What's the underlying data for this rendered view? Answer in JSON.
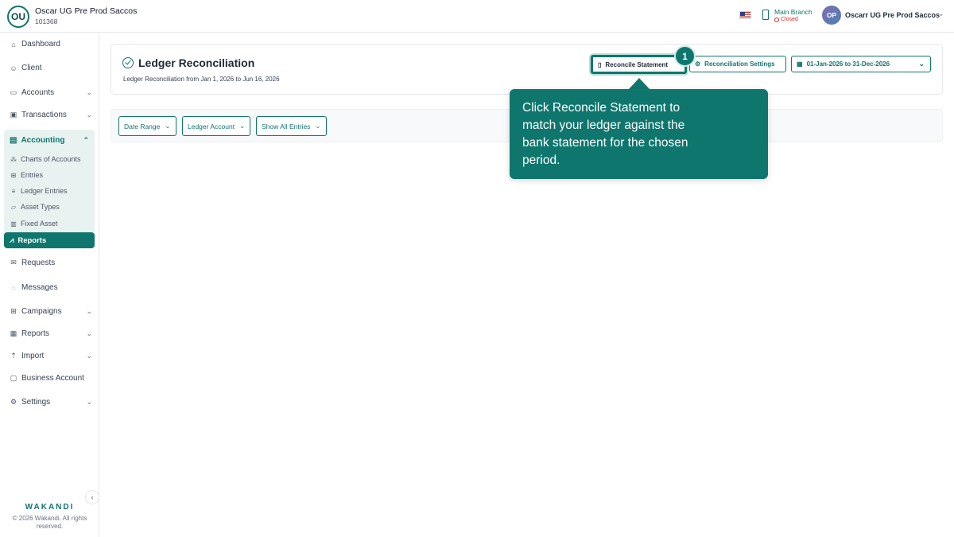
{
  "header": {
    "org_initials": "OU",
    "org_name": "Oscar UG Pre Prod Saccos",
    "org_id": "101368",
    "branch_name": "Main Branch",
    "branch_status": "Closed",
    "user_initials": "OP",
    "user_name": "Oscarr UG Pre Prod Saccos"
  },
  "sidebar": {
    "items": [
      {
        "label": "Dashboard",
        "icon": "home-icon"
      },
      {
        "label": "Client",
        "icon": "users-icon"
      },
      {
        "label": "Accounts",
        "icon": "wallet-icon"
      },
      {
        "label": "Transactions",
        "icon": "transactions-icon"
      }
    ],
    "accounting": {
      "label": "Accounting",
      "sub_items": [
        {
          "label": "Charts of Accounts",
          "icon": "sitemap-icon"
        },
        {
          "label": "Entries",
          "icon": "table-icon"
        },
        {
          "label": "Ledger Entries",
          "icon": "list-icon"
        },
        {
          "label": "Asset Types",
          "icon": "folder-icon"
        },
        {
          "label": "Fixed Asset",
          "icon": "building-icon"
        },
        {
          "label": "Reports",
          "icon": "chart-icon"
        }
      ]
    },
    "items_after": [
      {
        "label": "Requests",
        "icon": "mail-icon"
      },
      {
        "label": "Messages",
        "icon": "message-icon"
      },
      {
        "label": "Campaigns",
        "icon": "grid-icon"
      },
      {
        "label": "Reports",
        "icon": "bar-chart-icon"
      },
      {
        "label": "Import",
        "icon": "upload-icon"
      },
      {
        "label": "Business Account",
        "icon": "briefcase-icon"
      },
      {
        "label": "Settings",
        "icon": "gear-icon"
      }
    ],
    "brand": "WAKANDI",
    "copyright": "© 2026 Wakandi. All rights reserved."
  },
  "page": {
    "title": "Ledger Reconciliation",
    "subtitle": "Ledger Reconciliation from Jan 1, 2026 to Jun 16, 2026",
    "reconcile_label": "Reconcile Statement",
    "settings_label": "Reconciliation Settings",
    "date_range_value": "01-Jan-2026 to 31-Dec-2026"
  },
  "filters": {
    "date_range": "Date Range",
    "ledger_account": "Ledger Account",
    "show_entries": "Show All Entries"
  },
  "tour": {
    "step": "1",
    "text": "Click Reconcile Statement to match your ledger against the bank statement for the chosen period."
  },
  "colors": {
    "accent": "#0f766e",
    "accent_light": "#e8f3f1",
    "closed_status": "#dc2626"
  }
}
